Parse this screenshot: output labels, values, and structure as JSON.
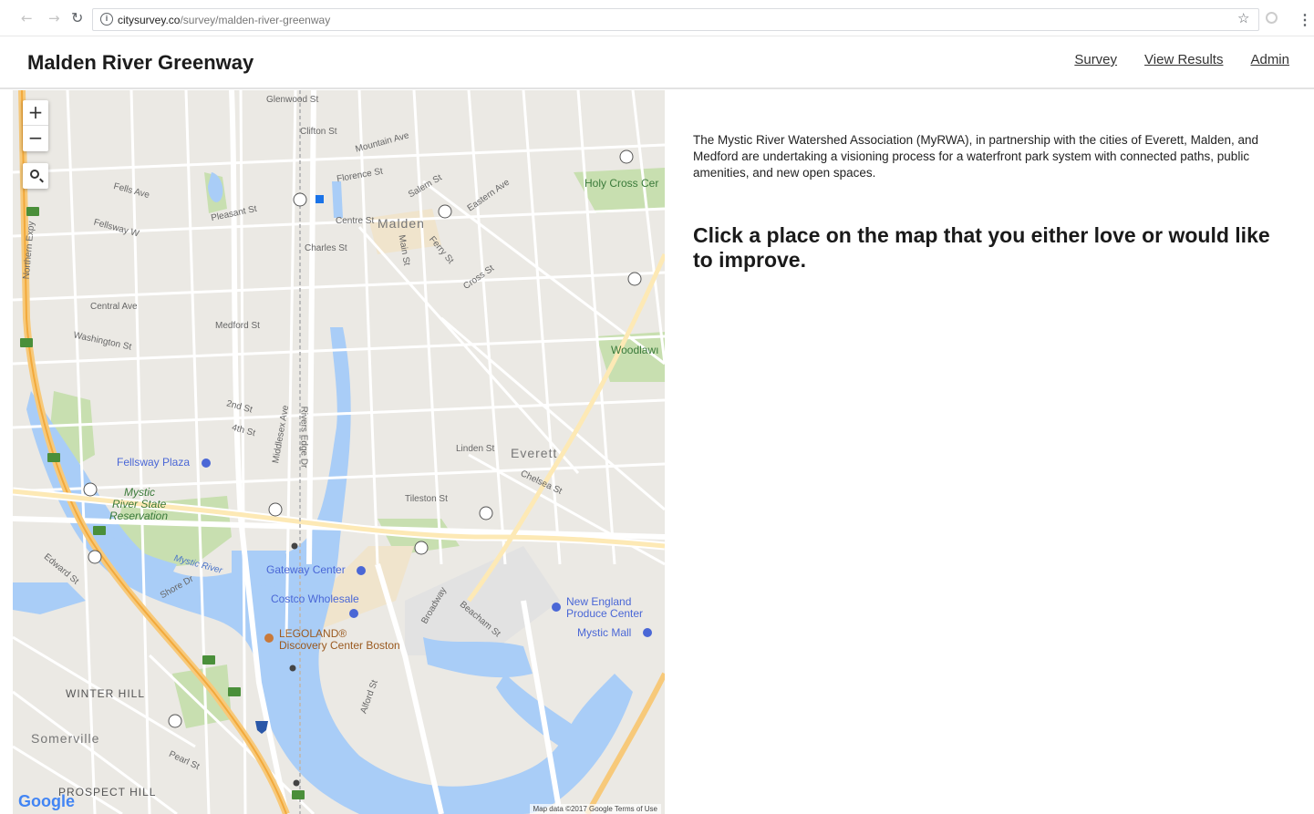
{
  "browser": {
    "back_icon": "arrow-left-icon",
    "forward_icon": "arrow-right-icon",
    "reload_icon": "reload-icon",
    "url_domain": "citysurvey.co",
    "url_path": "/survey/malden-river-greenway",
    "bookmark_icon": "star-icon"
  },
  "header": {
    "title": "Malden River Greenway",
    "nav": {
      "survey": "Survey",
      "results": "View Results",
      "admin": "Admin"
    }
  },
  "map": {
    "zoom_in": "+",
    "zoom_out": "−",
    "search_icon": "search-icon",
    "logo": "Google",
    "attribution": "Map data ©2017 Google   Terms of Use",
    "labels": {
      "malden": "Malden",
      "everett": "Everett",
      "somerville": "Somerville",
      "winter_hill": "WINTER HILL",
      "prospect_hill": "PROSPECT HILL",
      "holy_cross": "Holy Cross Cer",
      "woodlawn": "Woodlawı",
      "fellsway_plaza": "Fellsway Plaza",
      "mystic_res_1": "Mystic",
      "mystic_res_2": "River State",
      "mystic_res_3": "Reservation",
      "mystic_river": "Mystic River",
      "gateway": "Gateway Center",
      "costco": "Costco Wholesale",
      "legoland_1": "LEGOLAND®",
      "legoland_2": "Discovery Center Boston",
      "ne_produce_1": "New England",
      "ne_produce_2": "Produce Center",
      "mystic_mall": "Mystic Mall",
      "glenwood": "Glenwood St",
      "clifton": "Clifton St",
      "mountain": "Mountain Ave",
      "florence": "Florence St",
      "salem": "Salem St",
      "eastern": "Eastern Ave",
      "centre": "Centre St",
      "charles": "Charles St",
      "pleasant": "Pleasant St",
      "fells": "Fells Ave",
      "fellsway_w": "Fellsway W",
      "main": "Main St",
      "ferry": "Ferry St",
      "cross": "Cross St",
      "medford": "Medford St",
      "washington": "Washington St",
      "central": "Central Ave",
      "second": "2nd St",
      "fourth": "4th St",
      "rivers_edge": "Rivers Edge Dr",
      "middlesex": "Middlesex Ave",
      "linden": "Linden St",
      "tileston": "Tileston St",
      "chelsea": "Chelsea St",
      "broadway": "Broadway",
      "beacham": "Beacham St",
      "alford": "Alford St",
      "shore": "Shore Dr",
      "edward": "Edward St",
      "pearl": "Pearl St",
      "northern_expy": "Northern Expy"
    }
  },
  "content": {
    "intro": "The Mystic River Watershed Association (MyRWA), in partnership with the cities of Everett, Malden, and Medford are undertaking a visioning process for a waterfront park system with connected paths, public amenities, and new open spaces.",
    "prompt": "Click a place on the map that you either love or would like to improve."
  }
}
